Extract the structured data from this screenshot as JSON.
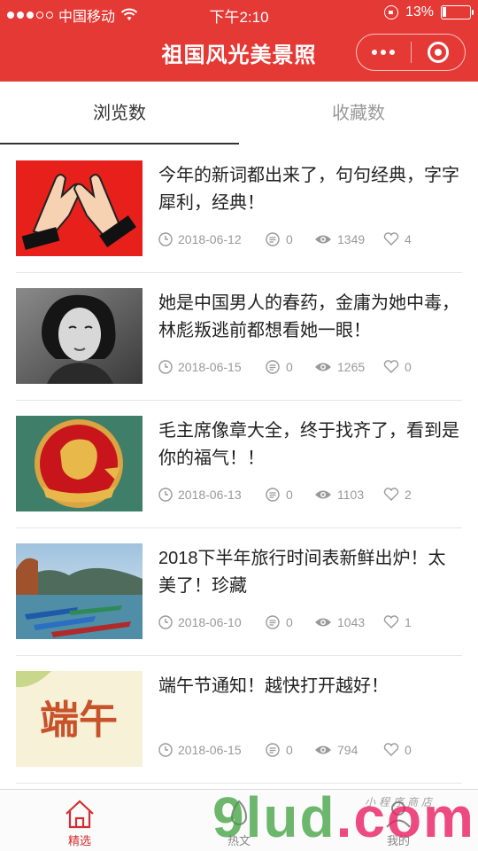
{
  "status_bar": {
    "carrier": "中国移动",
    "time": "下午2:10",
    "battery": "13%",
    "battery_level": 0.13
  },
  "header": {
    "title": "祖国风光美景照",
    "color": "#e53935"
  },
  "tabs": [
    {
      "label": "浏览数",
      "active": true
    },
    {
      "label": "收藏数",
      "active": false
    }
  ],
  "articles": [
    {
      "title": "今年的新词都出来了，句句经典，字字犀利，经典！",
      "date": "2018-06-12",
      "comments": "0",
      "views": "1349",
      "likes": "4"
    },
    {
      "title": "她是中国男人的春药，金庸为她中毒，林彪叛逃前都想看她一眼！",
      "date": "2018-06-15",
      "comments": "0",
      "views": "1265",
      "likes": "0"
    },
    {
      "title": "毛主席像章大全，终于找齐了，看到是你的福气！！",
      "date": "2018-06-13",
      "comments": "0",
      "views": "1103",
      "likes": "2"
    },
    {
      "title": "2018下半年旅行时间表新鲜出炉！太美了！珍藏",
      "date": "2018-06-10",
      "comments": "0",
      "views": "1043",
      "likes": "1"
    },
    {
      "title": "端午节通知！越快打开越好！",
      "date": "2018-06-15",
      "comments": "0",
      "views": "794",
      "likes": "0"
    }
  ],
  "thumb_text": {
    "duanwu": "端午"
  },
  "tabbar": [
    {
      "label": "精选",
      "icon": "home-icon",
      "active": true
    },
    {
      "label": "热文",
      "icon": "fire-icon",
      "active": false
    },
    {
      "label": "我的",
      "icon": "user-icon",
      "active": false
    }
  ],
  "watermark": {
    "main": "9lud",
    "suffix": ".com",
    "small": "小程序商店"
  }
}
